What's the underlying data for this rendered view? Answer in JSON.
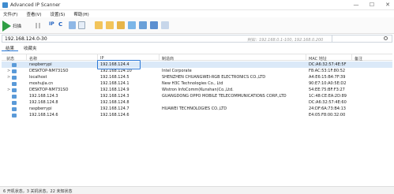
{
  "window": {
    "title": "Advanced IP Scanner",
    "controls": [
      "—",
      "☐",
      "✕"
    ]
  },
  "menu": [
    "文件(F)",
    "查看(V)",
    "设置(S)",
    "帮助(H)"
  ],
  "toolbar": {
    "scan_label": "扫描",
    "ip_label": "IP",
    "c_label": "C"
  },
  "address": {
    "value": "192.168.124.0-30",
    "hint": "例如：192.168.0.1-100, 192.168.0.200"
  },
  "tabs": [
    "结果",
    "收藏夹"
  ],
  "columns": [
    "状态",
    "名称",
    "IP",
    "制造商",
    "MAC 地址",
    "备注"
  ],
  "rows": [
    {
      "expand": "",
      "name": "raspberrypi",
      "ip": "192.168.124.4",
      "maker": "",
      "mac": "DC:A6:32:57:4E:5F",
      "selected": true
    },
    {
      "expand": ">",
      "name": "DESKTOP-NM731SO",
      "ip": "192.168.124.10",
      "maker": "Intel Corporate",
      "mac": "F8:AC:53:1F:80:52"
    },
    {
      "expand": ">",
      "name": "localhost",
      "ip": "192.168.124.5",
      "maker": "SHENZHEN CHUANGWEI-RGB ELECTRONICS CO.,LTD",
      "mac": "A4:E6:15:B4:7F:39"
    },
    {
      "expand": "",
      "name": "moshujia.cn",
      "ip": "192.168.124.1",
      "maker": "New H3C Technologies Co., Ltd",
      "mac": "90:E7:10:A0:5E:D2"
    },
    {
      "expand": ">",
      "name": "DESKTOP-NM731SO",
      "ip": "192.168.124.9",
      "maker": "Wistron InfoComm(Kunshan)Co.,Ltd.",
      "mac": "54:EE:75:BF:F3:27"
    },
    {
      "expand": "",
      "name": "192.168.124.3",
      "ip": "192.168.124.3",
      "maker": "GUANGDONG OPPO MOBILE TELECOMMUNICATIONS CORP.,LTD",
      "mac": "1C:48:CE:EA:2D:89"
    },
    {
      "expand": "",
      "name": "192.168.124.8",
      "ip": "192.168.124.8",
      "maker": "",
      "mac": "DC:A6:32:57:4E:60"
    },
    {
      "expand": "",
      "name": "raspberrypi",
      "ip": "192.168.124.7",
      "maker": "HUAWEI TECHNOLOGIES CO.,LTD",
      "mac": "24:DF:6A:73:B4:13"
    },
    {
      "expand": "",
      "name": "192.168.124.6",
      "ip": "192.168.124.6",
      "maker": "",
      "mac": "E4:05:F8:00:32:00"
    }
  ],
  "status": "6 开机状态，3 关机状态，22 未知状态",
  "colors": {
    "selection": "#dbe9f8",
    "highlight_border": "#2d79d7",
    "scan_green": "#2f9e44"
  }
}
